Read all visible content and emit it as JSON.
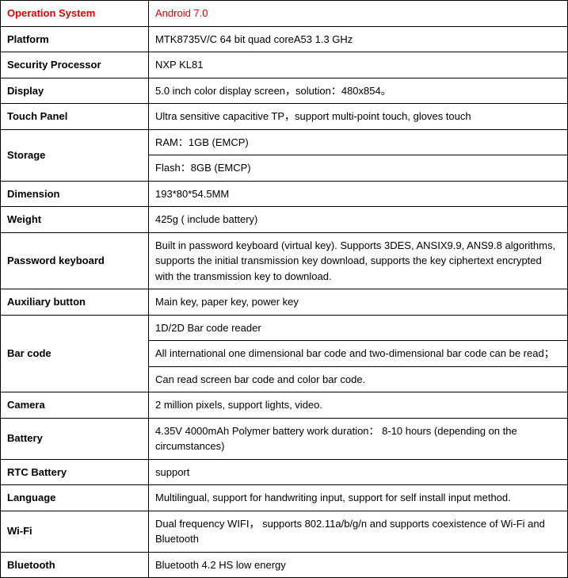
{
  "spec": {
    "os_label": "Operation System",
    "os_value": "Android 7.0",
    "platform_label": "Platform",
    "platform_value": "MTK8735V/C 64 bit  quad coreA53 1.3 GHz",
    "security_label": "Security Processor",
    "security_value": "NXP KL81",
    "display_label": "Display",
    "display_value": "5.0 inch color display screen，solution：480x854。",
    "touch_label": "Touch Panel",
    "touch_value": "Ultra sensitive capacitive TP，support multi-point touch, gloves touch",
    "storage_label": "Storage",
    "storage_ram": "RAM：1GB (EMCP)",
    "storage_flash": "Flash：8GB (EMCP)",
    "dimension_label": "Dimension",
    "dimension_value": "193*80*54.5MM",
    "weight_label": "Weight",
    "weight_value": "425g ( include battery)",
    "pwkb_label": "Password keyboard",
    "pwkb_value": "Built in password keyboard (virtual key). Supports 3DES, ANSIX9.9, ANS9.8 algorithms, supports the initial transmission key download, supports the key ciphertext encrypted with the transmission key to download.",
    "aux_label": "Auxiliary button",
    "aux_value": "Main key, paper key, power key",
    "barcode_label": "Bar code",
    "barcode_v1": "1D/2D Bar code reader",
    "barcode_v2": "All international one dimensional bar code and two-dimensional bar code can be read；",
    "barcode_v3": "Can read screen bar code and color bar code.",
    "camera_label": "Camera",
    "camera_value": "2 million pixels, support lights, video.",
    "battery_label": "Battery",
    "battery_value": "4.35V 4000mAh Polymer battery work duration： 8-10 hours (depending on the circumstances)",
    "rtc_label": "RTC Battery",
    "rtc_value": "support",
    "lang_label": "Language",
    "lang_value": "Multilingual, support for handwriting input, support for self install input method.",
    "wifi_label": "Wi-Fi",
    "wifi_value": "Dual frequency WIFI， supports 802.11a/b/g/n and supports coexistence of Wi-Fi and Bluetooth",
    "bt_label": "Bluetooth",
    "bt_value": "Bluetooth 4.2 HS low energy"
  }
}
